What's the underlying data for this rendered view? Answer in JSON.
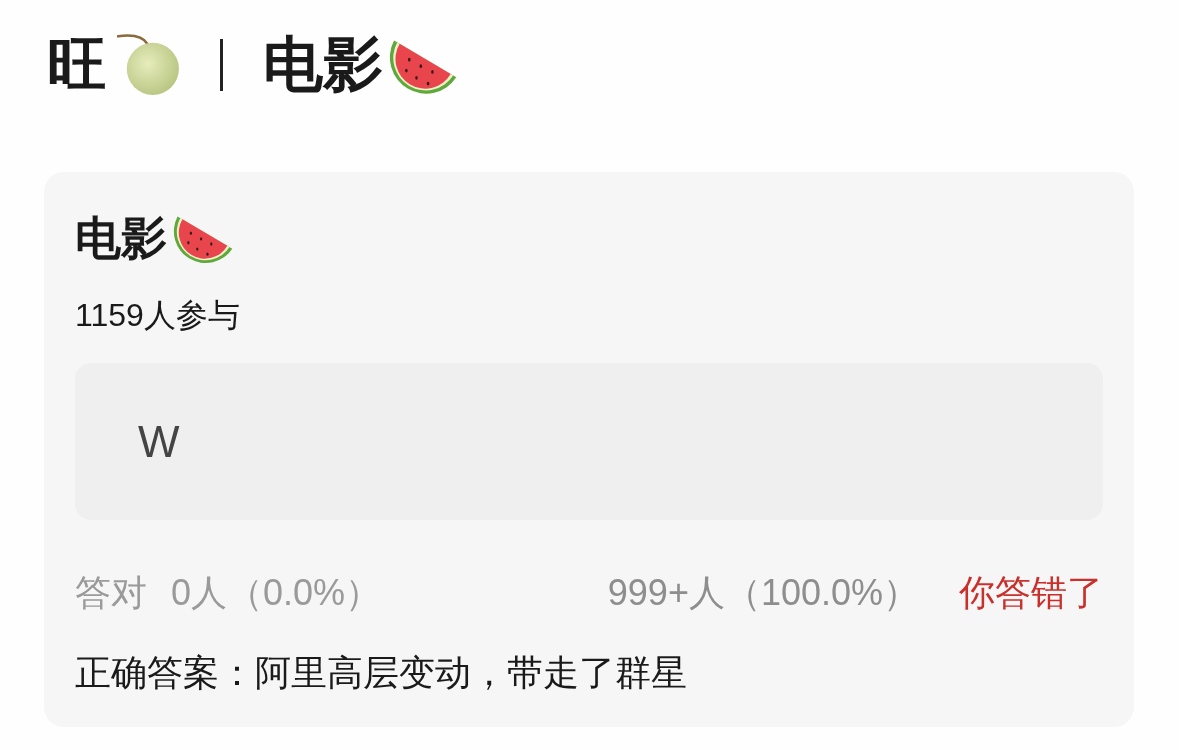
{
  "header": {
    "name": "旺",
    "topic": "电影"
  },
  "quiz_card": {
    "title": "电影",
    "participants": "1159人参与",
    "answer": {
      "value": "W"
    },
    "stats": {
      "correct_label": "答对",
      "correct_count": "0人（0.0%）",
      "wrong_count": "999+人（100.0%）"
    },
    "result": {
      "text": "你答错了",
      "correct": false
    },
    "correct_answer": "正确答案：阿里高层变动，带走了群星"
  }
}
